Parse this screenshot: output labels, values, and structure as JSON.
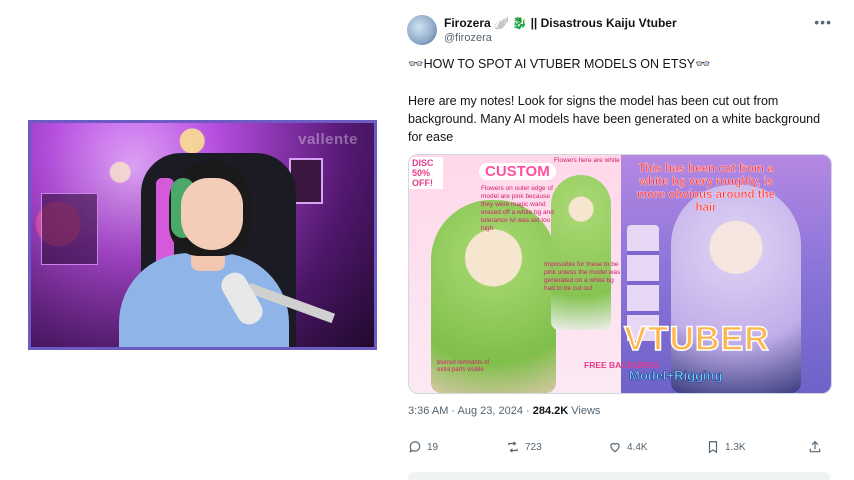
{
  "tweet": {
    "display_name": "Firozera 🪽 🐉 || Disastrous Kaiju Vtuber",
    "handle": "@firozera",
    "title": "👓HOW TO SPOT AI VTUBER MODELS ON ETSY👓",
    "body": "Here are my notes! Look for signs the model has been cut out from background. Many AI models have been generated on a white background for ease",
    "timestamp": "3:36 AM · Aug 23, 2024 · ",
    "views_count": "284.2K",
    "views_label": " Views",
    "actions": {
      "replies": "19",
      "reposts": "723",
      "likes": "4.4K",
      "bookmarks": "1.3K"
    }
  },
  "media": {
    "left": {
      "disc": "DISC 50% OFF!",
      "custom": "CUSTOM",
      "note_flowers_top": "Flowers here are white",
      "note_flowers_edge": "Flowers on outer edge of model are pink because they were magic wand erased off a white bg and tolerance lvl was set too high",
      "note_impossible": "Impossible for these to be pink unless the model was generated on a white bg had to be cut out",
      "note_blurred": "blurred remnants of extra parts visible",
      "free": "FREE BACKGROU"
    },
    "right": {
      "cut_note": "This has been cut from a white bg very roughly, is more obvious around the hair",
      "vtuber": "VTUBER",
      "model_rigging": "Model+Rigging"
    }
  },
  "webcam": {
    "watermark": "vallente"
  }
}
